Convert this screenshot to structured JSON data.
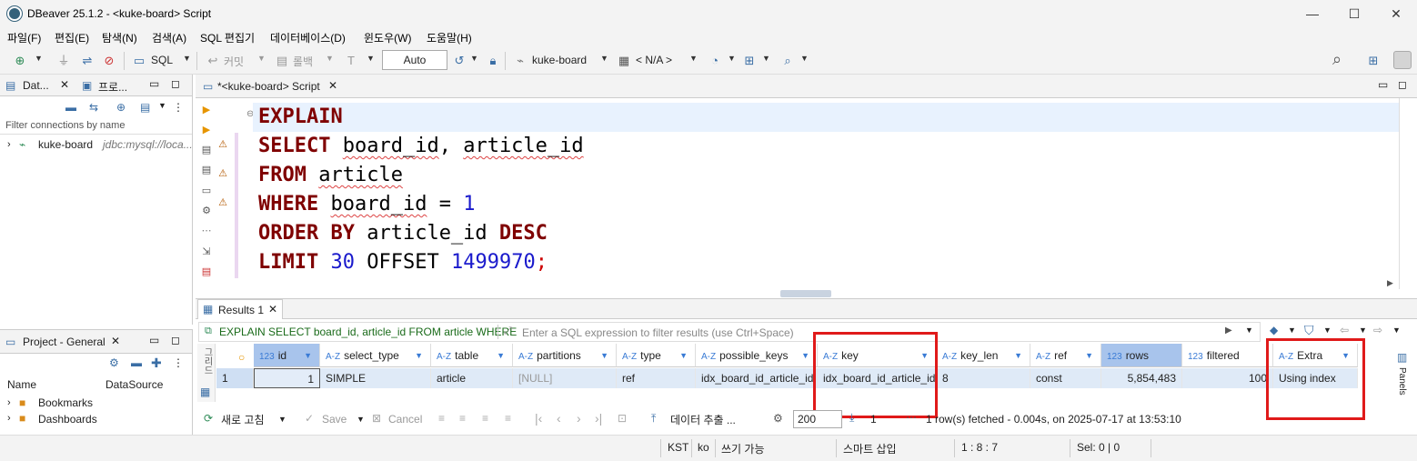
{
  "window": {
    "title": "DBeaver 25.1.2 - <kuke-board> Script",
    "minimize": "—",
    "maximize": "☐",
    "close": "✕"
  },
  "menu": [
    "파일(F)",
    "편집(E)",
    "탐색(N)",
    "검색(A)",
    "SQL 편집기",
    "데이터베이스(D)",
    "윈도우(W)",
    "도움말(H)"
  ],
  "toolbar": {
    "sql_label": "SQL",
    "commit_label": "커밋",
    "rollback_label": "롤백",
    "auto_label": "Auto",
    "connection_label": "kuke-board",
    "schema_label": "< N/A >"
  },
  "left_panel": {
    "tab1": "Dat...",
    "tab2": "프로...",
    "filter_placeholder": "Filter connections by name",
    "connection_name": "kuke-board",
    "connection_url": "jdbc:mysql://loca...",
    "project_tab": "Project - General",
    "col_name": "Name",
    "col_datasource": "DataSource",
    "items": [
      "Bookmarks",
      "Dashboards"
    ]
  },
  "editor": {
    "tab_label": "*<kuke-board> Script",
    "lines": {
      "l1_kw": "EXPLAIN",
      "l2_kw": "SELECT",
      "l2_a": "board_id",
      "l2_comma": ", ",
      "l2_b": "article_id",
      "l3_kw": "FROM",
      "l3_a": "article",
      "l4_kw": "WHERE",
      "l4_a": "board_id",
      "l4_op": " = ",
      "l4_num": "1",
      "l5_kw1": "ORDER BY",
      "l5_a": "article_id",
      "l5_kw2": "DESC",
      "l6_kw": "LIMIT",
      "l6_num1": "30",
      "l6_offset": "OFFSET",
      "l6_num2": "1499970",
      "l6_semi": ";"
    }
  },
  "results": {
    "tab_label": "Results 1",
    "query_label": "EXPLAIN SELECT board_id, article_id FROM article WHERE",
    "filter_placeholder": "Enter a SQL expression to filter results (use Ctrl+Space)",
    "side_label": "Panels",
    "columns": [
      {
        "type": "123",
        "name": "id"
      },
      {
        "type": "A-Z",
        "name": "select_type"
      },
      {
        "type": "A-Z",
        "name": "table"
      },
      {
        "type": "A-Z",
        "name": "partitions"
      },
      {
        "type": "A-Z",
        "name": "type"
      },
      {
        "type": "A-Z",
        "name": "possible_keys"
      },
      {
        "type": "A-Z",
        "name": "key"
      },
      {
        "type": "A-Z",
        "name": "key_len"
      },
      {
        "type": "A-Z",
        "name": "ref"
      },
      {
        "type": "123",
        "name": "rows"
      },
      {
        "type": "123",
        "name": "filtered"
      },
      {
        "type": "A-Z",
        "name": "Extra"
      }
    ],
    "row": {
      "rownum": "1",
      "id": "1",
      "select_type": "SIMPLE",
      "table": "article",
      "partitions": "[NULL]",
      "type": "ref",
      "possible_keys": "idx_board_id_article_id",
      "key": "idx_board_id_article_id",
      "key_len": "8",
      "ref": "const",
      "rows": "5,854,483",
      "filtered": "100",
      "extra": "Using index"
    },
    "bottom": {
      "refresh": "새로 고침",
      "save": "Save",
      "cancel": "Cancel",
      "export": "데이터 추출 ...",
      "fetch_size": "200",
      "count": "1",
      "status": "1 row(s) fetched - 0.004s, on 2025-07-17 at 13:53:10"
    }
  },
  "statusbar": {
    "tz": "KST",
    "lang": "ko",
    "mode": "쓰기 가능",
    "insert": "스마트 삽입",
    "pos": "1 : 8 : 7",
    "sel": "Sel: 0 | 0"
  },
  "colors": {
    "keyword": "#7f0000",
    "number": "#1a1acc",
    "highlight_box": "#e01a1a",
    "selected_row": "#dfeaf7"
  }
}
